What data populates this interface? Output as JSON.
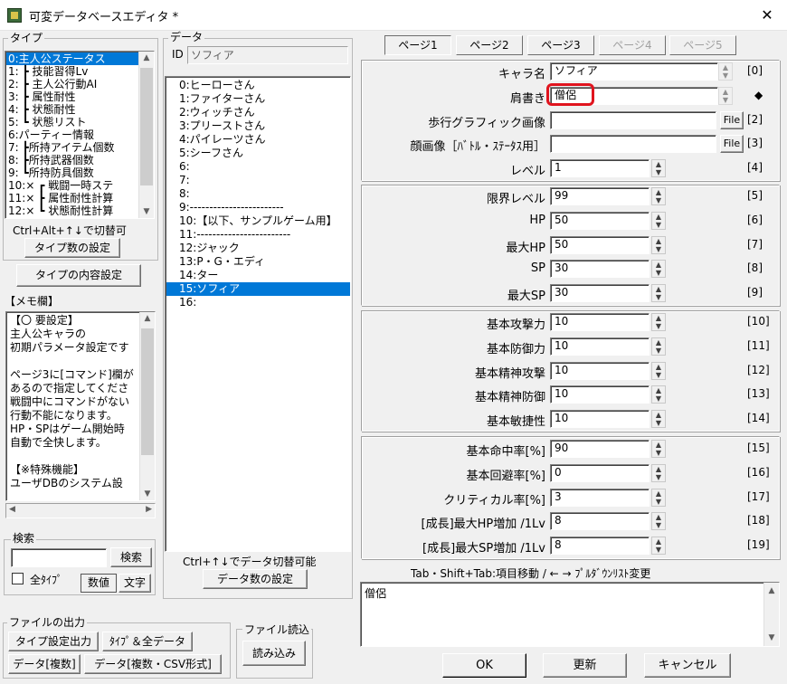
{
  "window": {
    "title": "可変データベースエディタ *",
    "close_glyph": "✕"
  },
  "type_panel": {
    "title": "タイプ",
    "items": [
      "0:主人公ステータス",
      "1: ┣ 技能習得Lv",
      "2: ┣ 主人公行動AI",
      "3: ┣ 属性耐性",
      "4: ┣ 状態耐性",
      "5: ┗ 状態リスト",
      "6:パーティー情報",
      "7: ┣所持アイテム個数",
      "8: ┣所持武器個数",
      "9: ┗所持防具個数",
      "10:× ┏ 戦闘一時ステ",
      "11:× ┣ 属性耐性計算",
      "12:× ┗ 状態耐性計算"
    ],
    "selected_index": 0,
    "hint": "Ctrl+Alt+↑↓で切替可",
    "type_count_button": "タイプ数の設定",
    "type_content_button": "タイプの内容設定"
  },
  "memo": {
    "title": "【メモ欄】",
    "lines": [
      "【〇 要設定】",
      "主人公キャラの",
      "初期パラメータ設定です",
      "",
      "ページ3に[コマンド]欄が",
      "あるので指定してくださ",
      "戦闘中にコマンドがない",
      "行動不能になります。",
      "HP・SPはゲーム開始時",
      "自動で全快します。",
      "",
      "【※特殊機能】",
      "ユーザDBのシステム設"
    ]
  },
  "search": {
    "title": "検索",
    "search_button": "検索",
    "all_types_label": "全ﾀｲﾌﾟ",
    "numeric_button": "数値",
    "text_button": "文字"
  },
  "file_output": {
    "title": "ファイルの出力",
    "type_settings_button": "タイプ設定出力",
    "type_all_button": "ﾀｲﾌﾟ＆全データ",
    "data_multi_button": "データ[複数]",
    "data_csv_button": "データ[複数・CSV形式]"
  },
  "file_read": {
    "title": "ファイル読込",
    "read_button": "読み込み"
  },
  "data_panel": {
    "title": "データ",
    "id_label": "ID",
    "id_value": "ソフィア",
    "items": [
      "0:ヒーローさん",
      "1:ファイターさん",
      "2:ウィッチさん",
      "3:プリーストさん",
      "4:パイレーツさん",
      "5:シーフさん",
      "6:",
      "7:",
      "8:",
      "9:------------------------",
      "10:【以下、サンプルゲーム用】",
      "11:------------------------",
      "12:ジャック",
      "13:P・G・エディ",
      "14:ター",
      "15:ソフィア",
      "16:"
    ],
    "selected_index": 15,
    "hint": "Ctrl+↑↓でデータ切替可能",
    "count_button": "データ数の設定"
  },
  "pages": {
    "tabs": [
      {
        "label": "ページ1",
        "state": "active"
      },
      {
        "label": "ページ2",
        "state": "normal"
      },
      {
        "label": "ページ3",
        "state": "normal"
      },
      {
        "label": "ページ4",
        "state": "disabled"
      },
      {
        "label": "ページ5",
        "state": "disabled"
      }
    ]
  },
  "fields_group1": [
    {
      "label": "キャラ名",
      "value": "ソフィア",
      "index": "[0]"
    },
    {
      "label": "肩書き",
      "value": "僧侶",
      "index": "◆"
    },
    {
      "label": "歩行グラフィック画像",
      "value": "",
      "index": "[2]",
      "button": "File"
    },
    {
      "label": "顔画像［ﾊﾞﾄﾙ・ｽﾃｰﾀｽ用］",
      "value": "",
      "index": "[3]",
      "button": "File"
    },
    {
      "label": "レベル",
      "value": "1",
      "index": "[4]"
    }
  ],
  "fields_group2": [
    {
      "label": "限界レベル",
      "value": "99",
      "index": "[5]"
    },
    {
      "label": "HP",
      "value": "50",
      "index": "[6]"
    },
    {
      "label": "最大HP",
      "value": "50",
      "index": "[7]"
    },
    {
      "label": "SP",
      "value": "30",
      "index": "[8]"
    },
    {
      "label": "最大SP",
      "value": "30",
      "index": "[9]"
    }
  ],
  "fields_group3": [
    {
      "label": "基本攻撃力",
      "value": "10",
      "index": "[10]"
    },
    {
      "label": "基本防御力",
      "value": "10",
      "index": "[11]"
    },
    {
      "label": "基本精神攻撃",
      "value": "10",
      "index": "[12]"
    },
    {
      "label": "基本精神防御",
      "value": "10",
      "index": "[13]"
    },
    {
      "label": "基本敏捷性",
      "value": "10",
      "index": "[14]"
    }
  ],
  "fields_group4": [
    {
      "label": "基本命中率[%]",
      "value": "90",
      "index": "[15]"
    },
    {
      "label": "基本回避率[%]",
      "value": "0",
      "index": "[16]"
    },
    {
      "label": "クリティカル率[%]",
      "value": "3",
      "index": "[17]"
    },
    {
      "label": "[成長]最大HP増加 /1Lv",
      "value": "8",
      "index": "[18]"
    },
    {
      "label": "[成長]最大SP増加 /1Lv",
      "value": "8",
      "index": "[19]"
    }
  ],
  "help_text": "Tab・Shift+Tab:項目移動 / ← → ﾌﾟﾙﾀﾞｳﾝﾘｽﾄ変更",
  "edit_area": {
    "value": "僧侶"
  },
  "footer": {
    "ok_button": "OK",
    "update_button": "更新",
    "cancel_button": "キャンセル"
  },
  "colors": {
    "highlight_border": "#e0141e",
    "selection": "#0078d7"
  },
  "icons": {
    "close": "close-icon",
    "app": "app-icon",
    "scroll_up": "up-arrow-icon",
    "scroll_down": "down-arrow-icon"
  }
}
